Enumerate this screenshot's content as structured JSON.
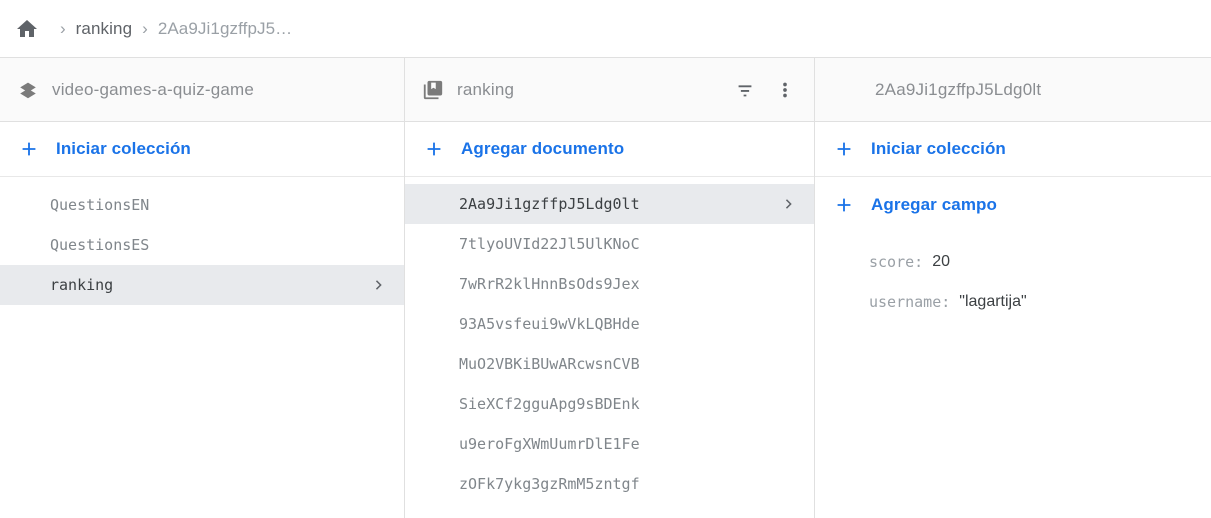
{
  "breadcrumb": {
    "home_icon": "home-icon",
    "separator": "›",
    "items": [
      {
        "label": "ranking"
      },
      {
        "label": "2Aa9Ji1gzffpJ5…"
      }
    ]
  },
  "colors": {
    "accent_blue": "#1a73e8",
    "selected_bg": "#e8eaed",
    "header_bg": "#fafafa",
    "text_gray": "#80868b",
    "border": "#e0e0e0"
  },
  "panel_database": {
    "header": {
      "icon": "firestore-database-icon",
      "title": "video-games-a-quiz-game"
    },
    "action": {
      "icon": "plus-icon",
      "label": "Iniciar colección"
    },
    "items": [
      {
        "label": "QuestionsEN",
        "selected": false
      },
      {
        "label": "QuestionsES",
        "selected": false
      },
      {
        "label": "ranking",
        "selected": true
      }
    ]
  },
  "panel_collection": {
    "header": {
      "icon": "collection-books-icon",
      "title": "ranking",
      "filter_icon": "filter-icon",
      "menu_icon": "more-vert-icon"
    },
    "action": {
      "icon": "plus-icon",
      "label": "Agregar documento"
    },
    "items": [
      {
        "label": "2Aa9Ji1gzffpJ5Ldg0lt",
        "selected": true
      },
      {
        "label": "7tlyoUVId22Jl5UlKNoC",
        "selected": false
      },
      {
        "label": "7wRrR2klHnnBsOds9Jex",
        "selected": false
      },
      {
        "label": "93A5vsfeui9wVkLQBHde",
        "selected": false
      },
      {
        "label": "MuO2VBKiBUwARcwsnCVB",
        "selected": false
      },
      {
        "label": "SieXCf2gguApg9sBDEnk",
        "selected": false
      },
      {
        "label": "u9eroFgXWmUumrDlE1Fe",
        "selected": false
      },
      {
        "label": "zOFk7ykg3gzRmM5zntgf",
        "selected": false
      }
    ]
  },
  "panel_document": {
    "header": {
      "title": "2Aa9Ji1gzffpJ5Ldg0lt"
    },
    "action_collection": {
      "icon": "plus-icon",
      "label": "Iniciar colección"
    },
    "action_field": {
      "icon": "plus-icon",
      "label": "Agregar campo"
    },
    "fields": [
      {
        "key": "score:",
        "value": "20"
      },
      {
        "key": "username:",
        "value": "\"lagartija\""
      }
    ]
  }
}
